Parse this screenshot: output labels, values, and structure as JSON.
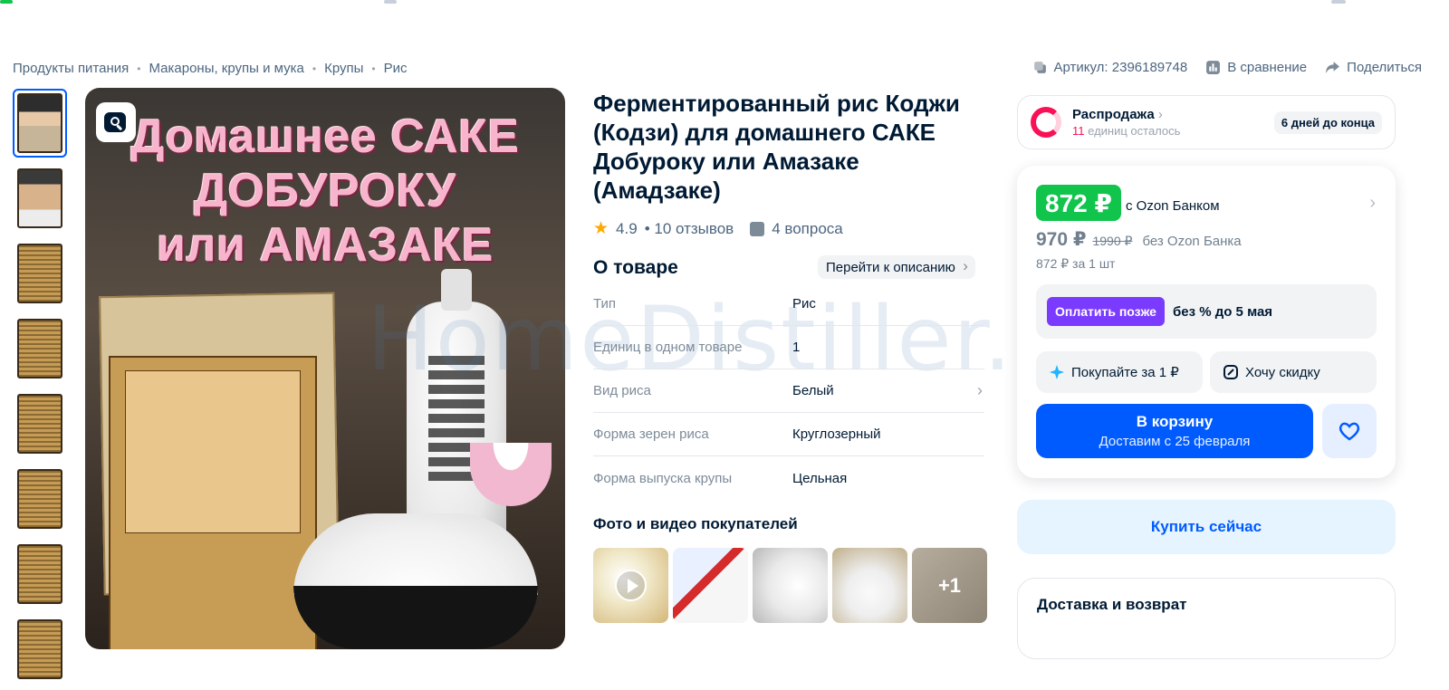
{
  "breadcrumbs": [
    "Продукты питания",
    "Макароны, крупы и мука",
    "Крупы",
    "Рис"
  ],
  "actions": {
    "article": "Артикул: 2396189748",
    "compare": "В сравнение",
    "share": "Поделиться"
  },
  "hero": {
    "title_lines": [
      "Домашнее САКЕ",
      "ДОБУРОКУ",
      "или АМАЗАКЕ"
    ]
  },
  "watermark": "HomeDistiller.ru",
  "product": {
    "title": "Ферментированный рис Коджи (Кодзи) для домашнего САКЕ Добуроку или Амазаке (Амадзаке)",
    "rating": "4.9",
    "reviews": "• 10 отзывов",
    "questions": "4 вопроса"
  },
  "about": {
    "heading": "О товаре",
    "goto_label": "Перейти к описанию",
    "specs": [
      {
        "k": "Тип",
        "v": "Рис"
      },
      {
        "k": "Единиц в одном товаре",
        "v": "1"
      },
      {
        "k": "Вид риса",
        "v": "Белый"
      },
      {
        "k": "Форма зерен риса",
        "v": "Круглозерный"
      },
      {
        "k": "Форма выпуска крупы",
        "v": "Цельная"
      }
    ]
  },
  "photos": {
    "heading": "Фото и видео покупателей",
    "more": "+1"
  },
  "sale": {
    "title": "Распродажа",
    "units_count": "11",
    "units_text": "единиц осталось",
    "days": "6 дней до конца"
  },
  "price": {
    "main": "872 ₽",
    "bank_label": "с Ozon Банком",
    "regular": "970 ₽",
    "old": "1990 ₽",
    "no_bank": "без Ozon Банка",
    "unit": "872 ₽ за 1 шт",
    "pay_later_btn": "Оплатить позже",
    "pay_later_txt": "без % до 5 мая",
    "buy_for_1": "Покупайте за 1 ₽",
    "want_discount": "Хочу скидку",
    "cart_label": "В корзину",
    "cart_sub": "Доставим с 25 февраля",
    "buy_now": "Купить сейчас"
  },
  "delivery": {
    "heading": "Доставка и возврат"
  },
  "colors": {
    "accent": "#005bff",
    "price_green": "#10c44c",
    "sale_pink": "#f91155",
    "pay_later_purple": "#7b3bff"
  }
}
